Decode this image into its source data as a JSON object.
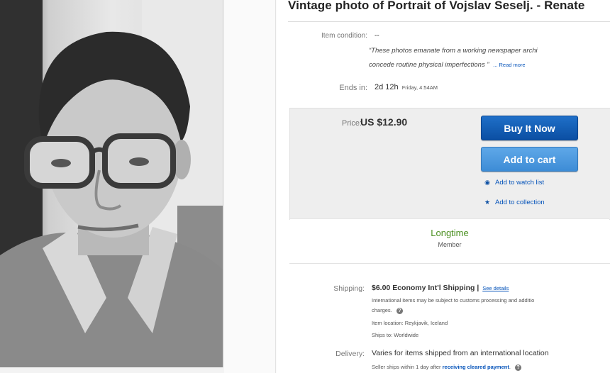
{
  "listing": {
    "title": "Vintage photo of Portrait of Vojslav Seselj. - Renate",
    "condition_label": "Item condition:",
    "condition_value": "--",
    "desc_line1": "“These photos emanate from a working newspaper archi",
    "desc_line2": "concede routine physical imperfections ”",
    "read_more": "... Read more",
    "ends_label": "Ends in:",
    "ends_value": "2d 12h",
    "ends_detail": "Friday, 4:54AM",
    "price_label": "Price:",
    "price_value": "US $12.90",
    "buy_now": "Buy It Now",
    "add_to_cart": "Add to cart",
    "watch_list": "Add to watch list",
    "collection": "Add to collection",
    "member_title": "Longtime",
    "member_sub": "Member",
    "shipping_label": "Shipping:",
    "shipping_value": "$6.00  Economy Int'l Shipping |",
    "see_details": "See details",
    "intl_note_1": "International items may be subject to customs processing and additio",
    "intl_note_2": "charges.",
    "item_location": "Item location:  Reykjavik, Iceland",
    "ships_to": "Ships to:  Worldwide",
    "delivery_label": "Delivery:",
    "delivery_value": "Varies for items shipped from an international location",
    "seller_ships_prefix": "Seller ships within 1 day after ",
    "seller_ships_link": "receiving cleared payment",
    "seller_ships_suffix": "."
  },
  "colors": {
    "buy_button": "#0b4fa3",
    "cart_button": "#3d8cd6",
    "link": "#0654ba",
    "member": "#4a8f1f"
  },
  "icons": {
    "watch": "eye-icon",
    "collection": "star-icon",
    "info": "info-icon"
  }
}
